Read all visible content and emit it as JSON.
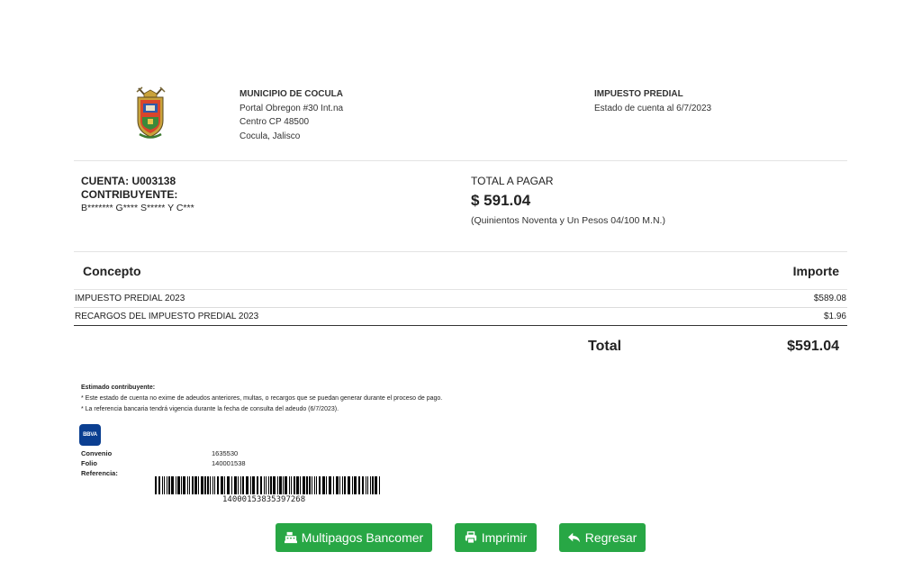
{
  "municipality": {
    "name": "MUNICIPIO DE COCULA",
    "address1": "Portal Obregon #30 Int.na",
    "address2": "Centro CP 48500",
    "address3": "Cocula, Jalisco"
  },
  "document": {
    "title": "IMPUESTO PREDIAL",
    "subtitle": "Estado de cuenta al 6/7/2023"
  },
  "account": {
    "cuenta_label": "CUENTA: U003138",
    "contribuyente_label": "CONTRIBUYENTE:",
    "contribuyente_name": "B******* G**** S***** Y C***"
  },
  "payment": {
    "label": "TOTAL A PAGAR",
    "amount": "$ 591.04",
    "amount_words": "(Quinientos Noventa y Un Pesos 04/100 M.N.)"
  },
  "table": {
    "headers": [
      "Concepto",
      "Importe"
    ],
    "rows": [
      {
        "concepto": "IMPUESTO PREDIAL 2023",
        "importe": "$589.08"
      },
      {
        "concepto": "RECARGOS DEL IMPUESTO PREDIAL 2023",
        "importe": "$1.96"
      }
    ],
    "total_label": "Total",
    "total_value": "$591.04"
  },
  "notes": {
    "heading": "Estimado contribuyente:",
    "line1": "* Este estado de cuenta no exime de adeudos anteriores, multas, o recargos que se puedan generar durante el proceso de pago.",
    "line2": "* La referencia bancaria tendrá vigencia durante la fecha de consulta del adeudo (6/7/2023)."
  },
  "bank": {
    "logo_text": "BBVA",
    "convenio_label": "Convenio",
    "convenio_value": "1635530",
    "folio_label": "Folio",
    "folio_value": "140001538",
    "referencia_label": "Referencia:",
    "barcode_number": "14000153835397268"
  },
  "buttons": {
    "multipagos": "Multipagos Bancomer",
    "imprimir": "Imprimir",
    "regresar": "Regresar"
  },
  "colors": {
    "button": "#28a745",
    "bbva": "#0b3f91"
  },
  "icons": {
    "multipagos": "cash-register-icon",
    "imprimir": "print-icon",
    "regresar": "reply-icon"
  }
}
